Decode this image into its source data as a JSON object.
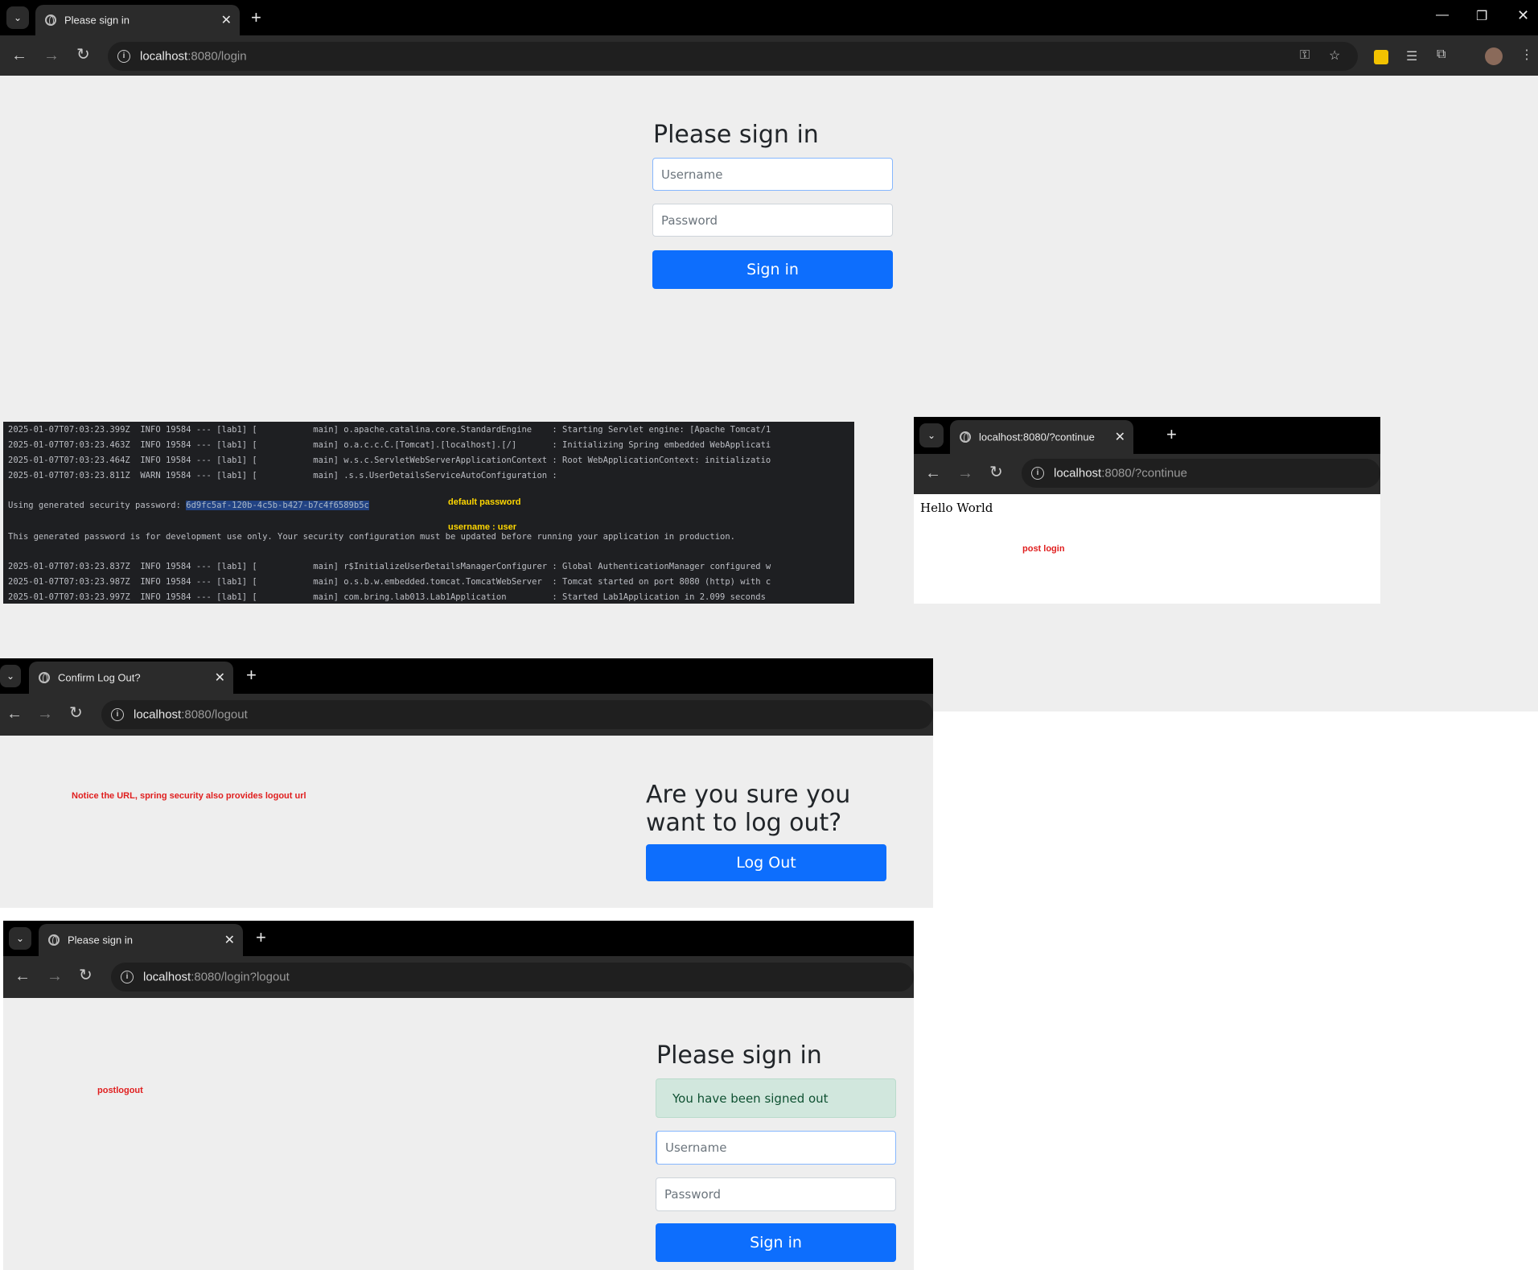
{
  "main": {
    "tab_title": "Please sign in",
    "url_host": "localhost",
    "url_path": ":8080/login",
    "heading": "Please sign in",
    "username_placeholder": "Username",
    "password_placeholder": "Password",
    "signin_label": "Sign in"
  },
  "terminal": {
    "lines": [
      "2025-01-07T07:03:23.399Z  INFO 19584 --- [lab1] [           main] o.apache.catalina.core.StandardEngine    : Starting Servlet engine: [Apache Tomcat/1",
      "2025-01-07T07:03:23.463Z  INFO 19584 --- [lab1] [           main] o.a.c.c.C.[Tomcat].[localhost].[/]       : Initializing Spring embedded WebApplicati",
      "2025-01-07T07:03:23.464Z  INFO 19584 --- [lab1] [           main] w.s.c.ServletWebServerApplicationContext : Root WebApplicationContext: initializatio",
      "2025-01-07T07:03:23.811Z  WARN 19584 --- [lab1] [           main] .s.s.UserDetailsServiceAutoConfiguration :",
      "2025-01-07T07:03:23.837Z  INFO 19584 --- [lab1] [           main] r$InitializeUserDetailsManagerConfigurer : Global AuthenticationManager configured w",
      "2025-01-07T07:03:23.987Z  INFO 19584 --- [lab1] [           main] o.s.b.w.embedded.tomcat.TomcatWebServer  : Tomcat started on port 8080 (http) with c",
      "2025-01-07T07:03:23.997Z  INFO 19584 --- [lab1] [           main] com.bring.lab013.Lab1Application         : Started Lab1Application in 2.099 seconds"
    ],
    "password_prefix": "Using generated security password: ",
    "password_value": "6d9fc5af-120b-4c5b-b427-b7c4f6589b5c",
    "dev_note": "This generated password is for development use only. Your security configuration must be updated before running your application in production.",
    "annot_default_password": "default password",
    "annot_username": "username : user"
  },
  "continue_window": {
    "tab_title": "localhost:8080/?continue",
    "url_host": "localhost",
    "url_path": ":8080/?continue",
    "body_text": "Hello World",
    "annotation": "post login"
  },
  "logout_window": {
    "tab_title": "Confirm Log Out?",
    "url_host": "localhost",
    "url_path": ":8080/logout",
    "heading": "Are you sure you want to log out?",
    "button_label": "Log Out",
    "annotation": "Notice the URL, spring security also provides logout url"
  },
  "postlogout_window": {
    "tab_title": "Please sign in",
    "url_host": "localhost",
    "url_path": ":8080/login?logout",
    "heading": "Please sign in",
    "alert_text": "You have been signed out",
    "username_placeholder": "Username",
    "password_placeholder": "Password",
    "signin_label": "Sign in",
    "annotation": "postlogout"
  }
}
